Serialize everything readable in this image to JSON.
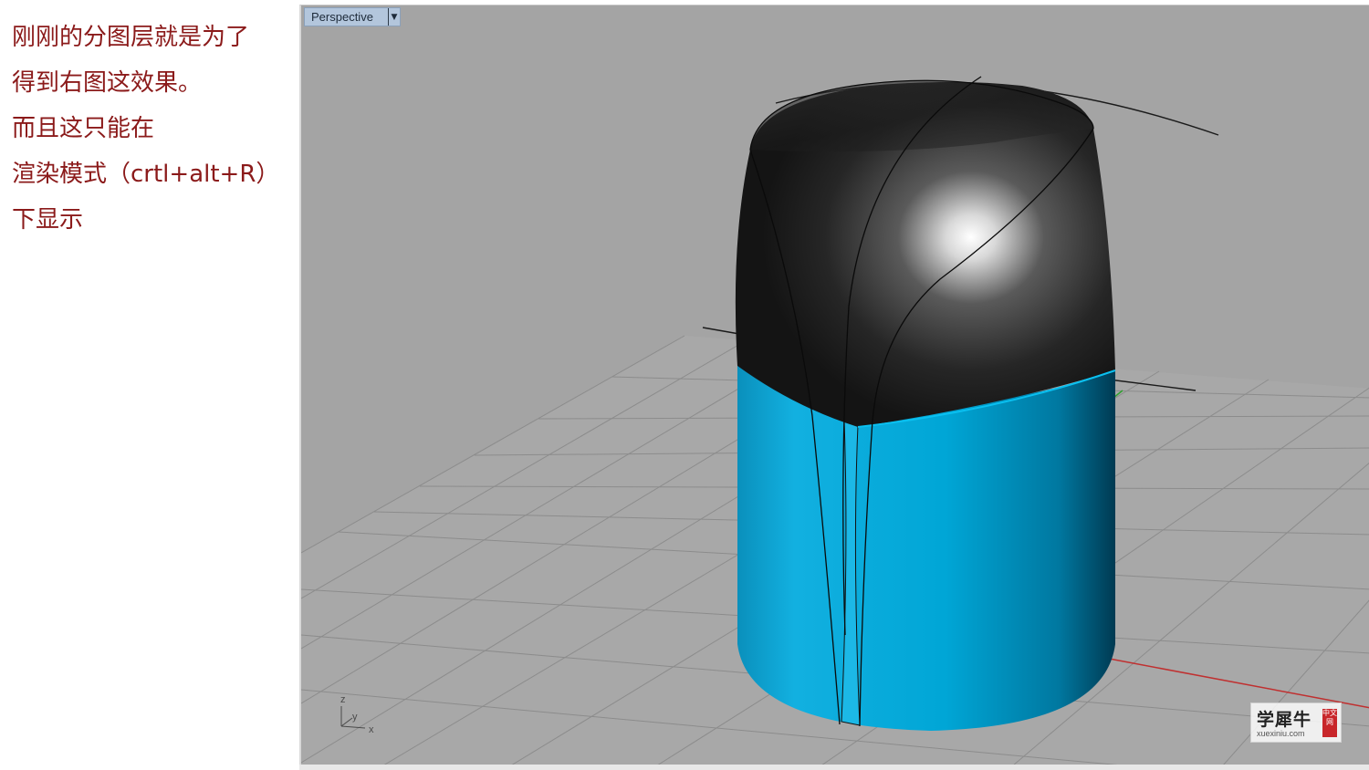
{
  "notes": {
    "lines": [
      "刚刚的分图层就是为了",
      "得到右图这效果。",
      "而且这只能在",
      "渲染模式（crtl+alt+R）",
      "下显示"
    ]
  },
  "viewport": {
    "title": "Perspective",
    "dropdown_icon": "chevron-down-icon",
    "axes": {
      "z": "z",
      "y": "y",
      "x": "x"
    }
  },
  "watermark": {
    "brand": "学犀牛",
    "domain": "xuexiniu.com",
    "seal": "中文网"
  },
  "colors": {
    "note_text": "#8b1a1a",
    "viewport_bg": "#a4a4a4",
    "grid_line": "#8e8e8e",
    "body_blue": "#00a8d8",
    "cap_black": "#1e1e1e",
    "x_axis": "#c03030",
    "y_axis": "#30a030"
  }
}
